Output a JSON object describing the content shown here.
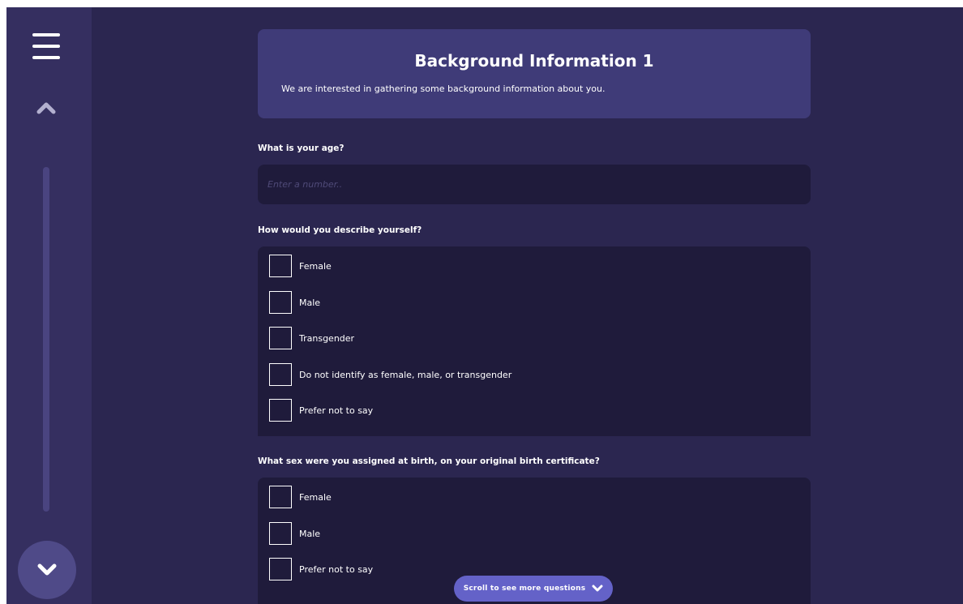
{
  "header": {
    "title": "Background Information 1",
    "subtitle": "We are interested in gathering some background information about you."
  },
  "questions": [
    {
      "label": "What is your age?",
      "input_placeholder": "Enter a number..",
      "input_value": ""
    },
    {
      "label": "How would you describe yourself?",
      "options": [
        "Female",
        "Male",
        "Transgender",
        "Do not identify as female, male, or transgender",
        "Prefer not to say"
      ]
    },
    {
      "label": "What sex were you assigned at birth, on your original birth certificate?",
      "options": [
        "Female",
        "Male",
        "Prefer not to say"
      ]
    }
  ],
  "scroll_hint": {
    "label": "Scroll to see more questions",
    "icon": "chevron-down-icon"
  },
  "sidebar": {
    "menu_icon": "hamburger-menu-icon",
    "up_icon": "chevron-up-icon",
    "down_icon": "chevron-down-icon"
  },
  "colors": {
    "background": "#2b2650",
    "sidebar": "#352f60",
    "header_card": "#3f3b78",
    "field": "#1f1b3b",
    "accent": "#6462c8"
  }
}
